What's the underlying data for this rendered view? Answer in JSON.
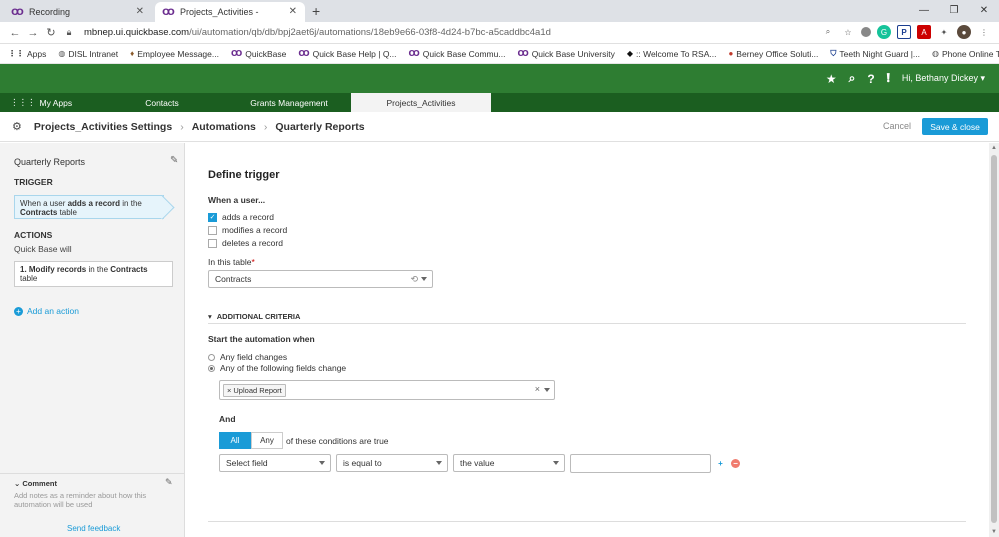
{
  "browser": {
    "tabs": [
      {
        "label": "Recording"
      },
      {
        "label": "Projects_Activities -"
      }
    ],
    "url_host": "mbnep.ui.quickbase.com",
    "url_path": "/ui/automation/qb/db/bpj2aet6j/automations/18eb9e66-03f8-4d24-b7bc-a5caddbc4a1d",
    "bookmarks": [
      {
        "label": "Apps"
      },
      {
        "label": "DISL Intranet"
      },
      {
        "label": "Employee Message..."
      },
      {
        "label": "QuickBase"
      },
      {
        "label": "Quick Base Help | Q..."
      },
      {
        "label": "Quick Base Commu..."
      },
      {
        "label": "Quick Base University"
      },
      {
        "label": ":: Welcome To RSA..."
      },
      {
        "label": "Berney Office Soluti..."
      },
      {
        "label": "Teeth Night Guard |..."
      },
      {
        "label": "Phone Online Tech..."
      }
    ],
    "ext_icons": [
      "G",
      "P",
      "A"
    ]
  },
  "qb": {
    "user_greeting": "Hi, Bethany Dickey",
    "my_apps": "My Apps",
    "app_tabs": [
      {
        "label": "Contacts"
      },
      {
        "label": "Grants Management"
      },
      {
        "label": "Projects_Activities"
      }
    ]
  },
  "settings": {
    "crumbs": [
      "Projects_Activities Settings",
      "Automations",
      "Quarterly Reports"
    ],
    "cancel": "Cancel",
    "save_close": "Save & close"
  },
  "sidebar": {
    "title": "Quarterly Reports",
    "trigger_heading": "TRIGGER",
    "trigger_card": {
      "pre": "When a user ",
      "bold": "adds a record",
      "mid": " in the ",
      "table": "Contracts",
      "post": " table"
    },
    "actions_heading": "ACTIONS",
    "qb_will": "Quick Base will",
    "action_card": {
      "pre": "1. Modify records",
      "mid": " in the ",
      "table": "Contracts",
      "post": " table"
    },
    "add_action": "Add an action",
    "comment_heading": "Comment",
    "comment_placeholder": "Add notes as a reminder about how this automation will be used",
    "send_feedback": "Send feedback"
  },
  "form": {
    "heading": "Define trigger",
    "when_user": "When a user...",
    "options": [
      {
        "label": "adds a record",
        "checked": true
      },
      {
        "label": "modifies a record",
        "checked": false
      },
      {
        "label": "deletes a record",
        "checked": false
      }
    ],
    "table_label": "In this table",
    "required_mark": "*",
    "table_value": "Contracts",
    "additional_criteria": "ADDITIONAL CRITERIA",
    "start_when": "Start the automation when",
    "radios": [
      {
        "label": "Any field changes",
        "selected": false
      },
      {
        "label": "Any of the following fields change",
        "selected": true
      }
    ],
    "chip_label": "Upload Report",
    "and_label": "And",
    "seg_all": "All",
    "seg_any": "Any",
    "conditions_text": "of these conditions are true",
    "cond_field": "Select field",
    "cond_op": "is equal to",
    "cond_val": "the value"
  }
}
